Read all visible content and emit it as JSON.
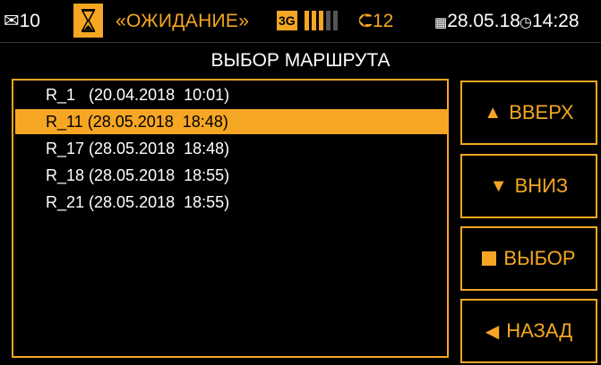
{
  "statusbar": {
    "mail_icon": "envelope-icon",
    "mail_count": "10",
    "state_icon": "hourglass-icon",
    "state_text": "«ОЖИДАНИЕ»",
    "network": "3G",
    "signal_level": 3,
    "signal_max": 5,
    "satellite_icon": "satellite-icon",
    "satellites": "12",
    "calendar_icon": "calendar-icon",
    "date": "28.05.18",
    "clock_icon": "clock-icon",
    "time": "14:28"
  },
  "title": "ВЫБОР МАРШРУТА",
  "routes": [
    {
      "label": "R_1   (20.04.2018  10:01)",
      "selected": false
    },
    {
      "label": "R_11 (28.05.2018  18:48)",
      "selected": true
    },
    {
      "label": "R_17 (28.05.2018  18:48)",
      "selected": false
    },
    {
      "label": "R_18 (28.05.2018  18:55)",
      "selected": false
    },
    {
      "label": "R_21 (28.05.2018  18:55)",
      "selected": false
    }
  ],
  "buttons": {
    "up": "ВВЕРХ",
    "down": "ВНИЗ",
    "select": "ВЫБОР",
    "back": "НАЗАД"
  },
  "colors": {
    "accent": "#f5a623",
    "background": "#000000",
    "text": "#ffffff",
    "inactive_bar": "#555555"
  }
}
